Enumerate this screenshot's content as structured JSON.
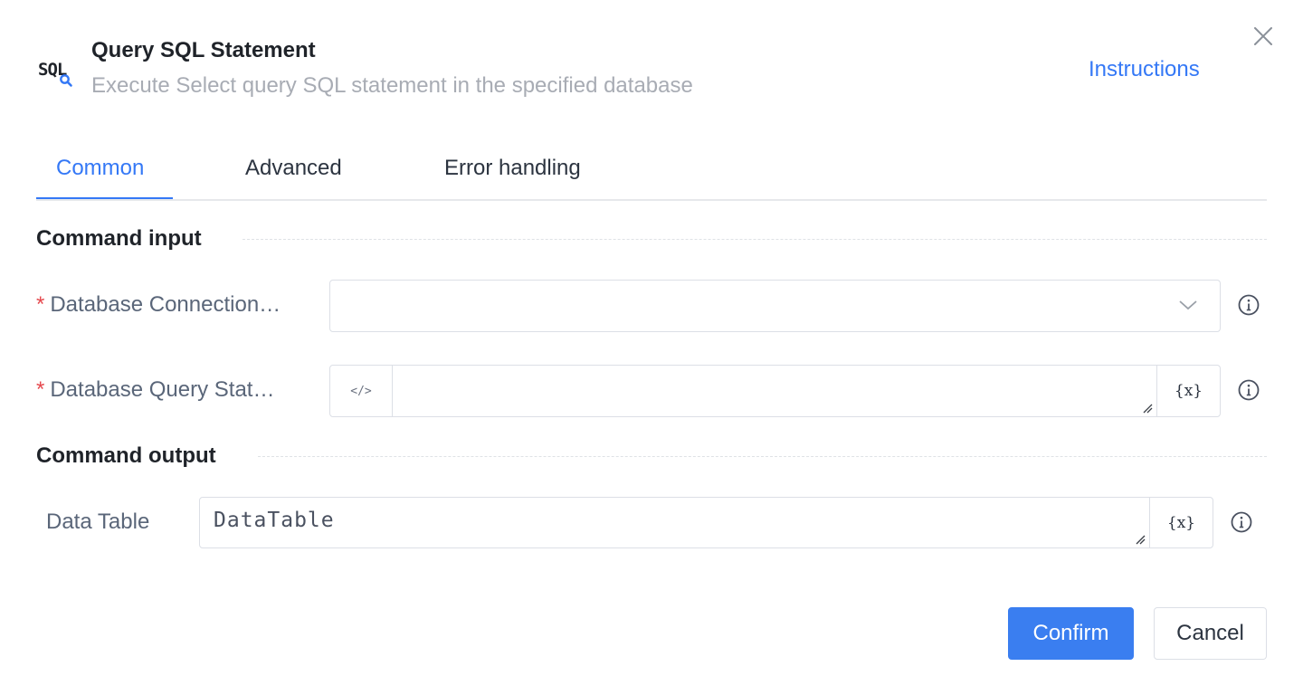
{
  "header": {
    "icon_text": "SQL",
    "title": "Query SQL Statement",
    "subtitle": "Execute Select query SQL statement in the specified database",
    "instructions_link": "Instructions"
  },
  "tabs": [
    {
      "label": "Common",
      "active": true
    },
    {
      "label": "Advanced",
      "active": false
    },
    {
      "label": "Error handling",
      "active": false
    }
  ],
  "command_input": {
    "title": "Command input",
    "fields": [
      {
        "label": "Database Connection…",
        "required": true,
        "type": "select",
        "value": ""
      },
      {
        "label": "Database Query Stat…",
        "required": true,
        "type": "code-textarea",
        "value": "",
        "left_addon": "</>",
        "right_addon": "{x}"
      }
    ]
  },
  "command_output": {
    "title": "Command output",
    "fields": [
      {
        "label": "Data Table",
        "required": false,
        "type": "textarea",
        "value": "DataTable",
        "right_addon": "{x}"
      }
    ]
  },
  "footer": {
    "confirm_label": "Confirm",
    "cancel_label": "Cancel"
  },
  "colors": {
    "accent": "#3478f6",
    "required": "#e5484d",
    "label": "#5a6679",
    "border": "#dcdfe6"
  },
  "icons": {
    "close": "close-icon",
    "chevron": "chevron-down-icon",
    "info": "info-icon",
    "code": "code-icon",
    "variable": "variable-icon",
    "sql": "sql-search-icon"
  }
}
